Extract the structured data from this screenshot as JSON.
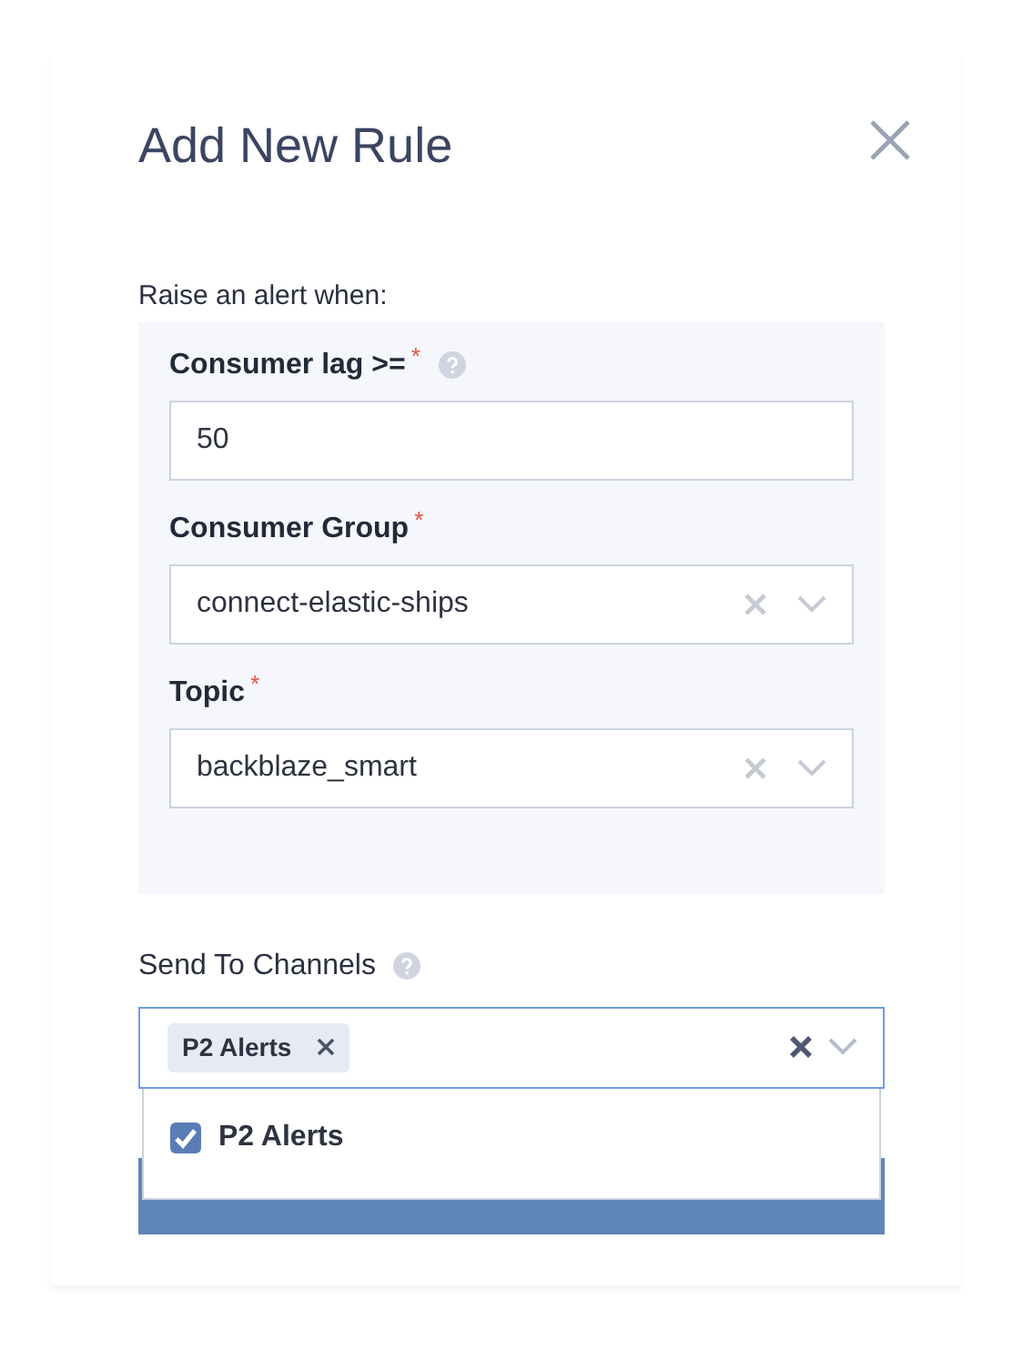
{
  "dialog": {
    "title": "Add New Rule"
  },
  "intro": "Raise an alert when:",
  "condition_fields": [
    {
      "kind": "number",
      "label": "Consumer lag >=",
      "required_mark": "*",
      "help": true,
      "value": "50"
    },
    {
      "kind": "select",
      "label": "Consumer Group",
      "required_mark": "*",
      "help": false,
      "value": "connect-elastic-ships"
    },
    {
      "kind": "select",
      "label": "Topic",
      "required_mark": "*",
      "help": false,
      "value": "backblaze_smart"
    }
  ],
  "channels": {
    "label": "Send To Channels",
    "help": true,
    "focused": true,
    "tags": [
      "P2 Alerts"
    ],
    "menu_options": [
      {
        "label": "P2 Alerts",
        "checked": true
      }
    ]
  }
}
